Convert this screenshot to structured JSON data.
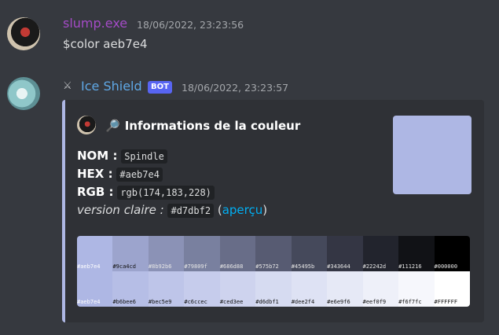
{
  "messages": [
    {
      "author": "slump.exe",
      "author_color": "#a44bc6",
      "timestamp": "18/06/2022, 23:23:56",
      "content": "$color aeb7e4"
    },
    {
      "author": "Ice Shield",
      "author_color": "#5fa8e6",
      "badge": "BOT",
      "timestamp": "18/06/2022, 23:23:57"
    }
  ],
  "embed": {
    "accent": "#aeb7e4",
    "title": "Informations de la couleur",
    "title_icon": "🔎",
    "fields": {
      "name_label": "NOM :",
      "name_value": "Spindle",
      "hex_label": "HEX :",
      "hex_value": "#aeb7e4",
      "rgb_label": "RGB :",
      "rgb_value": "rgb(174,183,228)",
      "light_label": "version claire :",
      "light_value": "#d7dbf2",
      "open_paren": " (",
      "preview_link": "aperçu",
      "close_paren": ")"
    },
    "thumbnail_color": "#aeb7e4",
    "palette": {
      "dark_row": [
        "#aeb7e4",
        "#9ca4cd",
        "#8b92b6",
        "#79809f",
        "#686d88",
        "#575b72",
        "#45495b",
        "#343644",
        "#22242d",
        "#111216",
        "#000000"
      ],
      "light_row": [
        "#aeb7e4",
        "#b6bee6",
        "#bec5e9",
        "#c6ccec",
        "#ced3ee",
        "#d6dbf1",
        "#dee2f4",
        "#e6e9f6",
        "#eef0f9",
        "#f6f7fc",
        "#FFFFFF"
      ]
    }
  }
}
